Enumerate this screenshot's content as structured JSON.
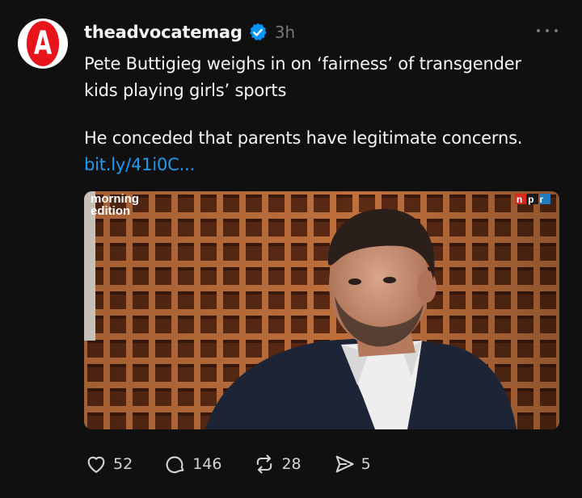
{
  "post": {
    "avatar_letter": "A",
    "username": "theadvocatemag",
    "timestamp": "3h",
    "headline": "Pete Buttigieg weighs in on ‘fairness’ of transgender kids playing girls’ sports",
    "body": "He conceded that parents have legitimate concerns.",
    "link_text": "bit.ly/41i0C...",
    "media": {
      "show_logo_line1": "morning",
      "show_logo_line2": "edition",
      "network_logo": "npr"
    }
  },
  "actions": {
    "likes": "52",
    "replies": "146",
    "reposts": "28",
    "shares": "5"
  },
  "colors": {
    "background": "#101010",
    "text": "#f3f5f7",
    "muted": "#777777",
    "link": "#1d9bf0",
    "verified": "#0095f6",
    "avatar_red": "#e8141b"
  },
  "icons": {
    "verified": "verified-badge-icon",
    "more": "more-options-icon",
    "like": "heart-icon",
    "reply": "comment-bubble-icon",
    "repost": "repost-icon",
    "share": "send-icon"
  }
}
